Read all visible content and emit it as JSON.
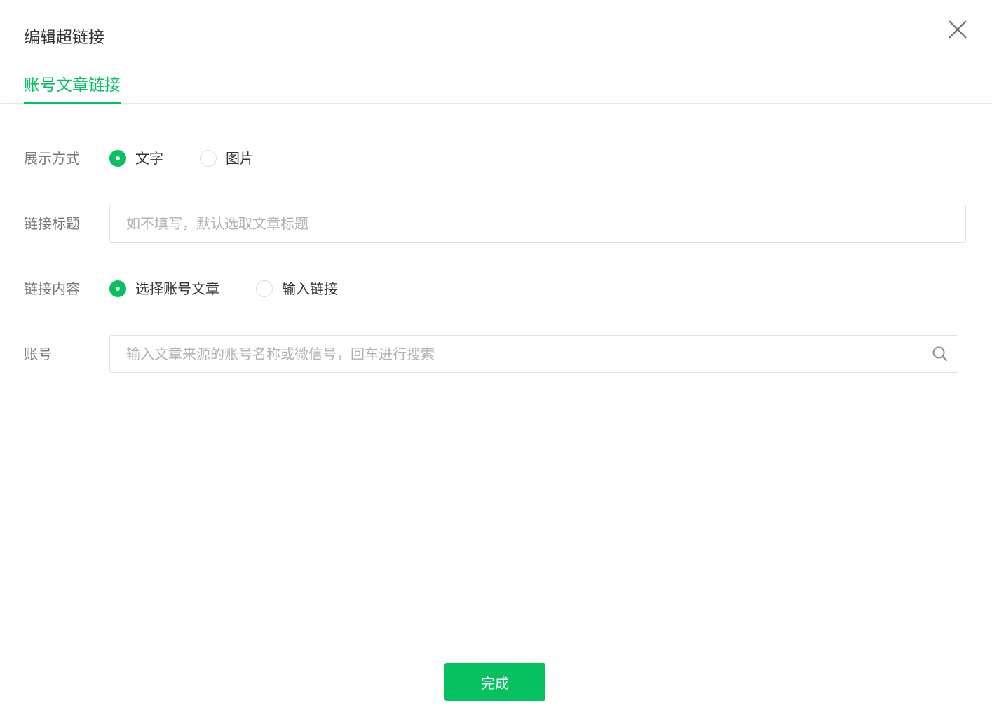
{
  "dialog": {
    "title": "编辑超链接",
    "close_icon": "close-icon"
  },
  "tabs": [
    {
      "label": "账号文章链接",
      "active": true
    }
  ],
  "form": {
    "display_mode": {
      "label": "展示方式",
      "options": [
        {
          "label": "文字",
          "checked": true
        },
        {
          "label": "图片",
          "checked": false
        }
      ]
    },
    "link_title": {
      "label": "链接标题",
      "value": "",
      "placeholder": "如不填写，默认选取文章标题"
    },
    "link_content": {
      "label": "链接内容",
      "options": [
        {
          "label": "选择账号文章",
          "checked": true
        },
        {
          "label": "输入链接",
          "checked": false
        }
      ]
    },
    "account": {
      "label": "账号",
      "value": "",
      "placeholder": "输入文章来源的账号名称或微信号，回车进行搜索",
      "icon": "search-icon"
    }
  },
  "footer": {
    "done_label": "完成"
  },
  "colors": {
    "accent": "#07c160",
    "text": "#353535",
    "label": "#767676",
    "placeholder": "#b2b2b2",
    "border": "#e0e0e0"
  }
}
